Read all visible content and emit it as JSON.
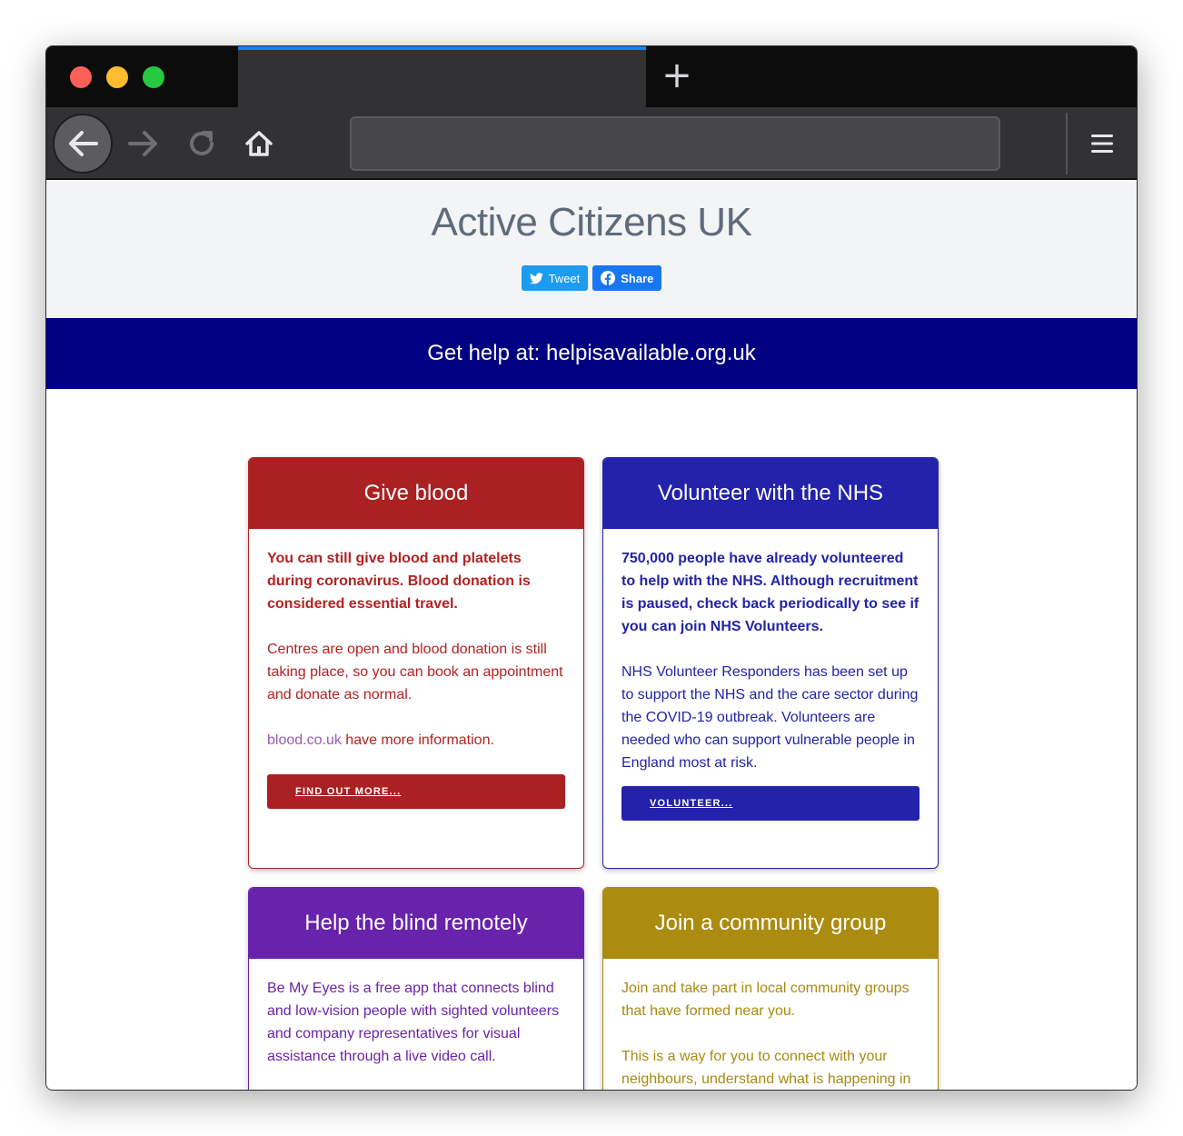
{
  "browser": {
    "new_tab_icon": "plus-icon",
    "icons": [
      "back-arrow-icon",
      "forward-arrow-icon",
      "reload-icon",
      "home-icon",
      "hamburger-menu-icon"
    ],
    "url": ""
  },
  "page": {
    "title": "Active Citizens UK",
    "tweet_label": "Tweet",
    "share_label": "Share",
    "banner": "Get help at: helpisavailable.org.uk"
  },
  "cards": {
    "blood": {
      "title": "Give blood",
      "lead": "You can still give blood and platelets during coronavirus. Blood donation is considered essential travel.",
      "text": "Centres are open and blood donation is still taking place, so you can book an appointment and donate as normal.",
      "link": "blood.co.uk",
      "link_suffix": " have more information.",
      "button": "FIND OUT MORE...",
      "color": "#ab2022"
    },
    "nhs": {
      "title": "Volunteer with the NHS",
      "lead": "750,000 people have already volunteered to help with the NHS. Although recruitment is paused, check back periodically to see if you can join NHS Volunteers.",
      "text": "NHS Volunteer Responders has been set up to support the NHS and the care sector during the COVID-19 outbreak. Volunteers are needed who can support vulnerable people in England most at risk.",
      "button": "VOLUNTEER...",
      "color": "#2222aa"
    },
    "blind": {
      "title": "Help the blind remotely",
      "text": "Be My Eyes is a free app that connects blind and low-vision people with sighted volunteers and company representatives for visual assistance through a live video call.",
      "color": "#6822ab"
    },
    "community": {
      "title": "Join a community group",
      "text1": "Join and take part in local community groups that have formed near you.",
      "text2": "This is a way for you to connect with your neighbours, understand what is happening in",
      "color": "#ab8b10"
    }
  }
}
